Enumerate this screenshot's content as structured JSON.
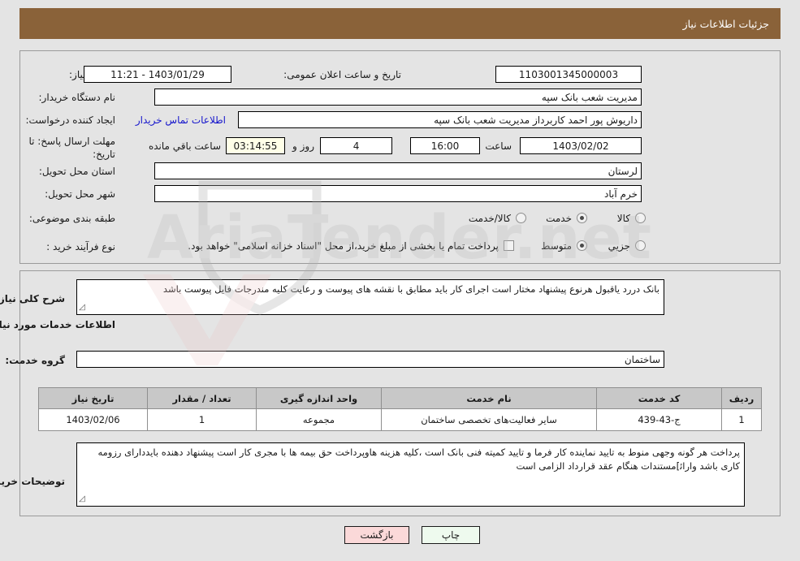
{
  "window": {
    "title": "جزئیات اطلاعات نیاز"
  },
  "form": {
    "need_number_label": "شماره نیاز:",
    "need_number_value": "1103001345000003",
    "public_announce_label": "تاریخ و ساعت اعلان عمومی:",
    "public_announce_value": "1403/01/29 - 11:21",
    "buyer_org_label": "نام دستگاه خریدار:",
    "buyer_org_value": "مدیریت شعب بانک سپه",
    "requester_label": "ایجاد کننده درخواست:",
    "requester_value": "داریوش پور احمد کاربرداز مدیریت شعب بانک سپه",
    "contact_link": "اطلاعات تماس خریدار",
    "deadline_label": "مهلت ارسال پاسخ: تا تاریخ:",
    "deadline_date": "1403/02/02",
    "hour_label": "ساعت",
    "hour_value": "16:00",
    "days_value": "4",
    "days_unit_label": "روز و",
    "countdown_value": "03:14:55",
    "countdown_suffix_label": "ساعت باقي مانده",
    "province_label": "استان محل تحویل:",
    "province_value": "لرستان",
    "city_label": "شهر محل تحویل:",
    "city_value": "خرم آباد",
    "classification_label": "طبقه بندی موضوعی:",
    "classification_options": [
      "کالا",
      "خدمت",
      "کالا/خدمت"
    ],
    "classification_selected": "خدمت",
    "process_label": "نوع فرآیند خرید :",
    "process_options": [
      "جزیي",
      "متوسط"
    ],
    "process_selected": "متوسط",
    "treasury_checkbox_label": "پرداخت تمام یا بخشی از مبلغ خرید،از محل \"اسناد خزانه اسلامی\" خواهد بود.",
    "treasury_checked": false
  },
  "description": {
    "label": "شرح کلی نیاز:",
    "text": "بانک دررد یاقبول هرنوع پیشنهاد مختار است  اجرای کار باید مطابق با نقشه های پیوست و رعایت کلیه مندرجات فایل پیوست باشد"
  },
  "services_section": {
    "heading": "اطلاعات خدمات مورد نیاز",
    "group_label": "گروه خدمت:",
    "group_value": "ساختمان",
    "table": {
      "headers": [
        "ردیف",
        "کد خدمت",
        "نام خدمت",
        "واحد اندازه گیری",
        "تعداد / مقدار",
        "تاریخ نیاز"
      ],
      "rows": [
        [
          "1",
          "ج-43-439",
          "سایر فعالیت‌های تخصصی ساختمان",
          "مجموعه",
          "1",
          "1403/02/06"
        ]
      ]
    }
  },
  "buyer_notes": {
    "label": "توضیحات خریدار:",
    "text": "پرداخت هر گونه وجهی منوط به تایید نماینده کار فرما و تایید کمیته فنی بانک است ،کلیه هزینه هاوپرداخت حق بیمه ها با مجری کار است پیشنهاد دهنده بایددارای رزومه کاری باشد واراﺋ]مستندات هنگام عقد قرارداد الزامی است"
  },
  "buttons": {
    "print": "چاپ",
    "back": "بازگشت"
  },
  "watermark": {
    "text": "AriaTender.net"
  },
  "colors": {
    "titlebar": "#8a6239",
    "page_bg": "#e4e4e4",
    "link": "#1414cc",
    "table_header": "#c8c8c8",
    "print_btn": "#eefaee",
    "back_btn": "#fbd9d9",
    "countdown_bg": "#ffffe8"
  }
}
